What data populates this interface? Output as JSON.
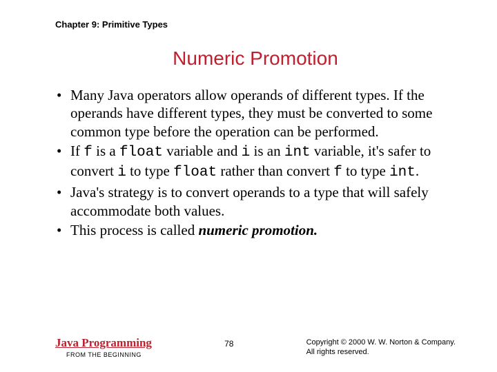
{
  "chapter": "Chapter 9: Primitive Types",
  "title": "Numeric Promotion",
  "bullets": {
    "b1a": "Many Java operators allow operands of different types. If the operands have different types, they must be converted to some common type before the operation can be performed.",
    "b2_pre": "If ",
    "b2_f1": "f",
    "b2_t1": " is a ",
    "b2_float1": "float",
    "b2_t2": " variable and ",
    "b2_i1": "i",
    "b2_t3": " is an ",
    "b2_int1": "int",
    "b2_t4": " variable, it's safer to convert ",
    "b2_i2": "i",
    "b2_t5": " to type ",
    "b2_float2": "float",
    "b2_t6": " rather than convert ",
    "b2_f2": "f",
    "b2_t7": " to type ",
    "b2_int2": "int",
    "b2_t8": ".",
    "b3": "Java's strategy is to convert operands to a type that will safely accommodate both values.",
    "b4_pre": "This process is called ",
    "b4_em": "numeric promotion.",
    "b4_post": ""
  },
  "footer": {
    "book_title": "Java Programming",
    "book_sub": "FROM THE BEGINNING",
    "page": "78",
    "copyright_line1": "Copyright © 2000 W. W. Norton & Company.",
    "copyright_line2": "All rights reserved."
  }
}
